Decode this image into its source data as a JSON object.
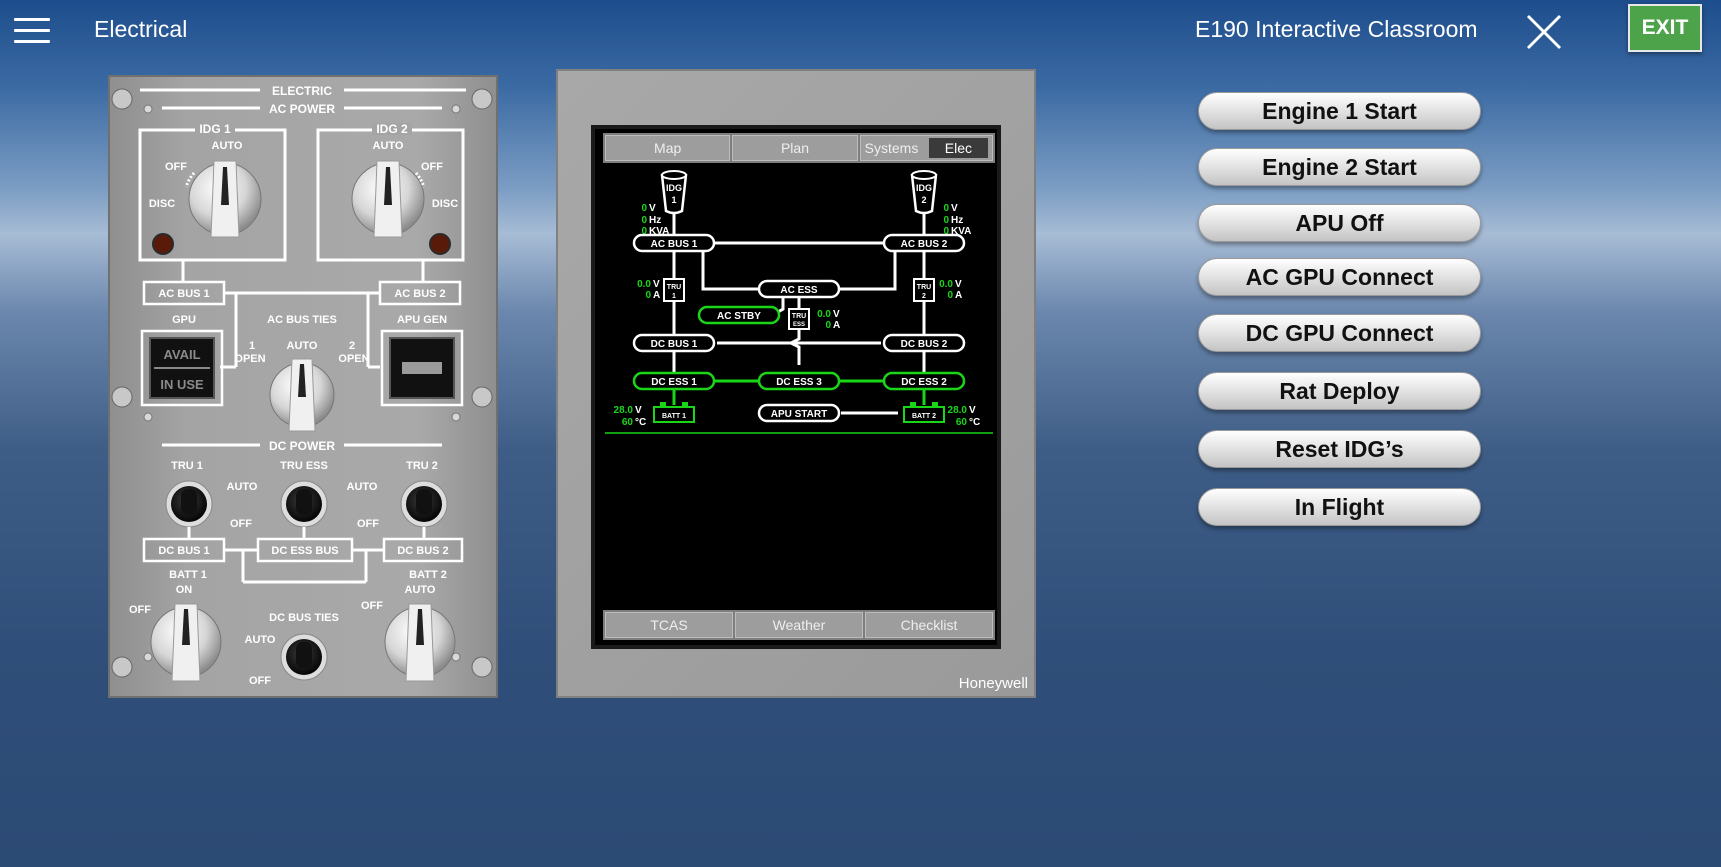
{
  "header": {
    "section_title": "Electrical",
    "app_title": "E190 Interactive Classroom",
    "exit_label": "EXIT"
  },
  "overhead_panel": {
    "title": "ELECTRIC",
    "ac_power": "AC POWER",
    "idg1": {
      "label": "IDG 1",
      "auto": "AUTO",
      "off": "OFF",
      "disc": "DISC"
    },
    "idg2": {
      "label": "IDG 2",
      "auto": "AUTO",
      "off": "OFF",
      "disc": "DISC"
    },
    "ac_bus_1": "AC BUS 1",
    "ac_bus_2": "AC BUS 2",
    "gpu": {
      "label": "GPU",
      "avail": "AVAIL",
      "in_use": "IN USE"
    },
    "ac_bus_ties": {
      "label": "AC BUS TIES",
      "auto": "AUTO",
      "one": "1",
      "two": "2",
      "open": "OPEN"
    },
    "apu_gen": "APU GEN",
    "dc_power": "DC POWER",
    "tru1": "TRU 1",
    "tru_ess": "TRU ESS",
    "tru2": "TRU 2",
    "auto": "AUTO",
    "off": "OFF",
    "dc_bus_1": "DC BUS 1",
    "dc_ess_bus": "DC ESS BUS",
    "dc_bus_2": "DC BUS 2",
    "batt1": {
      "label": "BATT 1",
      "on": "ON",
      "off": "OFF"
    },
    "batt2": {
      "label": "BATT 2",
      "auto": "AUTO",
      "off": "OFF"
    },
    "dc_bus_ties": {
      "label": "DC BUS TIES",
      "auto": "AUTO",
      "off": "OFF"
    }
  },
  "display": {
    "brand": "Honeywell",
    "top_tabs": [
      "Map",
      "Plan"
    ],
    "systems_label": "Systems",
    "systems_selected": "Elec",
    "bottom_tabs": [
      "TCAS",
      "Weather",
      "Checklist"
    ],
    "synoptic": {
      "idg1": {
        "name": "IDG",
        "num": "1",
        "v": "0",
        "hz": "0",
        "kva": "0"
      },
      "idg2": {
        "name": "IDG",
        "num": "2",
        "v": "0",
        "hz": "0",
        "kva": "0"
      },
      "units": {
        "v": "V",
        "hz": "Hz",
        "kva": "KVA",
        "a": "A",
        "c": "°C"
      },
      "ac_bus_1": "AC BUS 1",
      "ac_bus_2": "AC BUS 2",
      "ac_ess": "AC ESS",
      "ac_stby": "AC STBY",
      "tru1": {
        "name": "TRU",
        "num": "1",
        "v": "0.0",
        "a": "0"
      },
      "tru2": {
        "name": "TRU",
        "num": "2",
        "v": "0.0",
        "a": "0"
      },
      "tru_ess": {
        "name": "TRU",
        "sub": "ESS",
        "v": "0.0",
        "a": "0"
      },
      "dc_bus_1": "DC BUS 1",
      "dc_bus_2": "DC BUS 2",
      "dc_ess_1": "DC ESS 1",
      "dc_ess_2": "DC ESS 2",
      "dc_ess_3": "DC ESS 3",
      "apu_start": "APU START",
      "batt1": {
        "name": "BATT 1",
        "v": "28.0",
        "c": "60"
      },
      "batt2": {
        "name": "BATT 2",
        "v": "28.0",
        "c": "60"
      },
      "colors": {
        "green": "#19d619",
        "white": "#ffffff"
      }
    }
  },
  "actions": [
    "Engine 1 Start",
    "Engine 2 Start",
    "APU Off",
    "AC GPU Connect",
    "DC GPU Connect",
    "Rat Deploy",
    "Reset IDG’s",
    "In Flight"
  ]
}
